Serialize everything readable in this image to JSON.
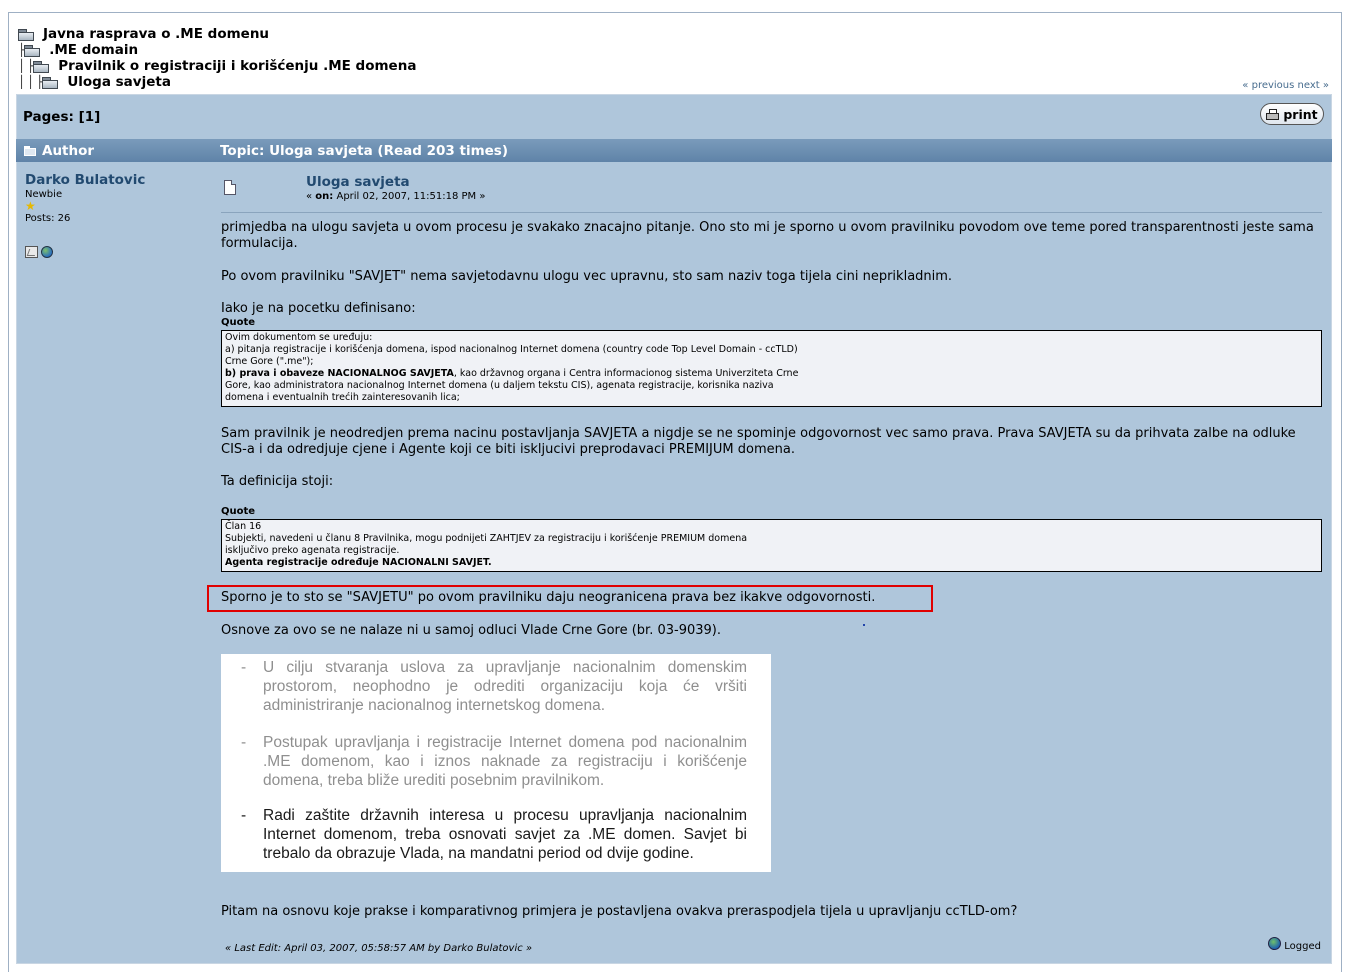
{
  "breadcrumb": [
    {
      "prefix": "",
      "label": "Javna rasprava o .ME domenu"
    },
    {
      "prefix": "├",
      "label": ".ME domain"
    },
    {
      "prefix": "│ ├",
      "label": "Pravilnik o registraciji i korišćenju .ME domena"
    },
    {
      "prefix": "│ │ ├",
      "label": "Uloga savjeta"
    }
  ],
  "nav": {
    "previous": "« previous",
    "next": "next »"
  },
  "pages": {
    "label": "Pages: [1]"
  },
  "print_button": {
    "label": "print"
  },
  "header": {
    "author": "Author",
    "topic": "Topic: Uloga savjeta  (Read 203 times)"
  },
  "author": {
    "name": "Darko Bulatovic",
    "rank": "Newbie",
    "star": "★",
    "posts": "Posts: 26"
  },
  "post": {
    "subject": "Uloga savjeta",
    "posted_prefix": "« ",
    "posted_on_label": "on:",
    "posted_date": " April 02, 2007, 11:51:18 PM »",
    "paragraphs": [
      "primjedba na ulogu savjeta u ovom procesu je svakako znacajno pitanje. Ono sto mi je sporno u ovom pravilniku povodom ove teme pored transparentnosti jeste sama formulacija.",
      "Po ovom pravilniku \"SAVJET\" nema savjetodavnu ulogu vec upravnu, sto sam naziv toga tijela cini neprikladnim.",
      "Iako je na pocetku definisano:",
      "Sam pravilnik je neodredjen prema nacinu postavljanja SAVJETA a nigdje se ne spominje odgovornost vec samo prava. Prava SAVJETA su da prihvata zalbe na odluke CIS-a i da odredjuje cjene i Agente koji ce biti iskljucivi preprodavaci PREMIJUM domena.",
      "Ta definicija stoji:",
      "Sporno je to sto se \"SAVJETU\" po ovom pravilniku daju neogranicena prava bez ikakve odgovornosti.",
      "Osnove za ovo se ne nalaze ni u samoj odluci Vlade Crne Gore (br. 03-9039).",
      "Pitam na osnovu koje prakse i komparativnog primjera je postavljena ovakva preraspodjela tijela u upravljanju ccTLD-om?"
    ],
    "quote_label": "Quote",
    "quote1": {
      "l1": "Ovim dokumentom se uređuju:",
      "l2": "a) pitanja registracije i korišćenja domena, ispod nacionalnog Internet domena (country code Top Level Domain - ccTLD)",
      "l3": "Crne Gore (\".me\");",
      "l4_bold": "b) prava i obaveze NACIONALNOG SAVJETA",
      "l4_rest": ", kao državnog organa i Centra informacionog sistema Univerziteta Crne",
      "l5": "Gore, kao administratora nacionalnog Internet domena (u daljem tekstu CIS), agenata registracije, korisnika naziva",
      "l6": "domena i eventualnih trećih zainteresovanih lica;"
    },
    "quote2": {
      "l1": "Član 16",
      "l2": "Subjekti, navedeni u članu 8 Pravilnika, mogu podnijeti ZAHTJEV za registraciju i korišćenje PREMIUM domena",
      "l3": "isključivo preko agenata registracije.",
      "l4_bold": "Agenta registracije određuje NACIONALNI SAVJET."
    },
    "scanned_image": {
      "dash": "-",
      "item1": "U cilju stvaranja uslova za upravljanje nacionalnim domenskim prostorom, neophodno je odrediti organizaciju koja će vršiti administriranje nacionalnog internetskog domena.",
      "item2": "Postupak upravljanja i registracije Internet domena pod nacionalnim .ME domenom, kao i iznos naknade za registraciju i korišćenje domena, treba bliže urediti posebnim pravilnikom.",
      "item3": "Radi zaštite državnih interesa u procesu upravljanja nacionalnim Internet domenom, treba osnovati savjet za .ME domen. Savjet bi trebalo da obrazuje Vlada, na mandatni period od dvije godine."
    },
    "last_edit": "« Last Edit: April 03, 2007, 05:58:57 AM by Darko Bulatovic »",
    "logged": "Logged"
  },
  "colors": {
    "panel": "#afc6db",
    "header": "#6b8fb3",
    "link": "#224a70",
    "highlight": "#e00000"
  }
}
